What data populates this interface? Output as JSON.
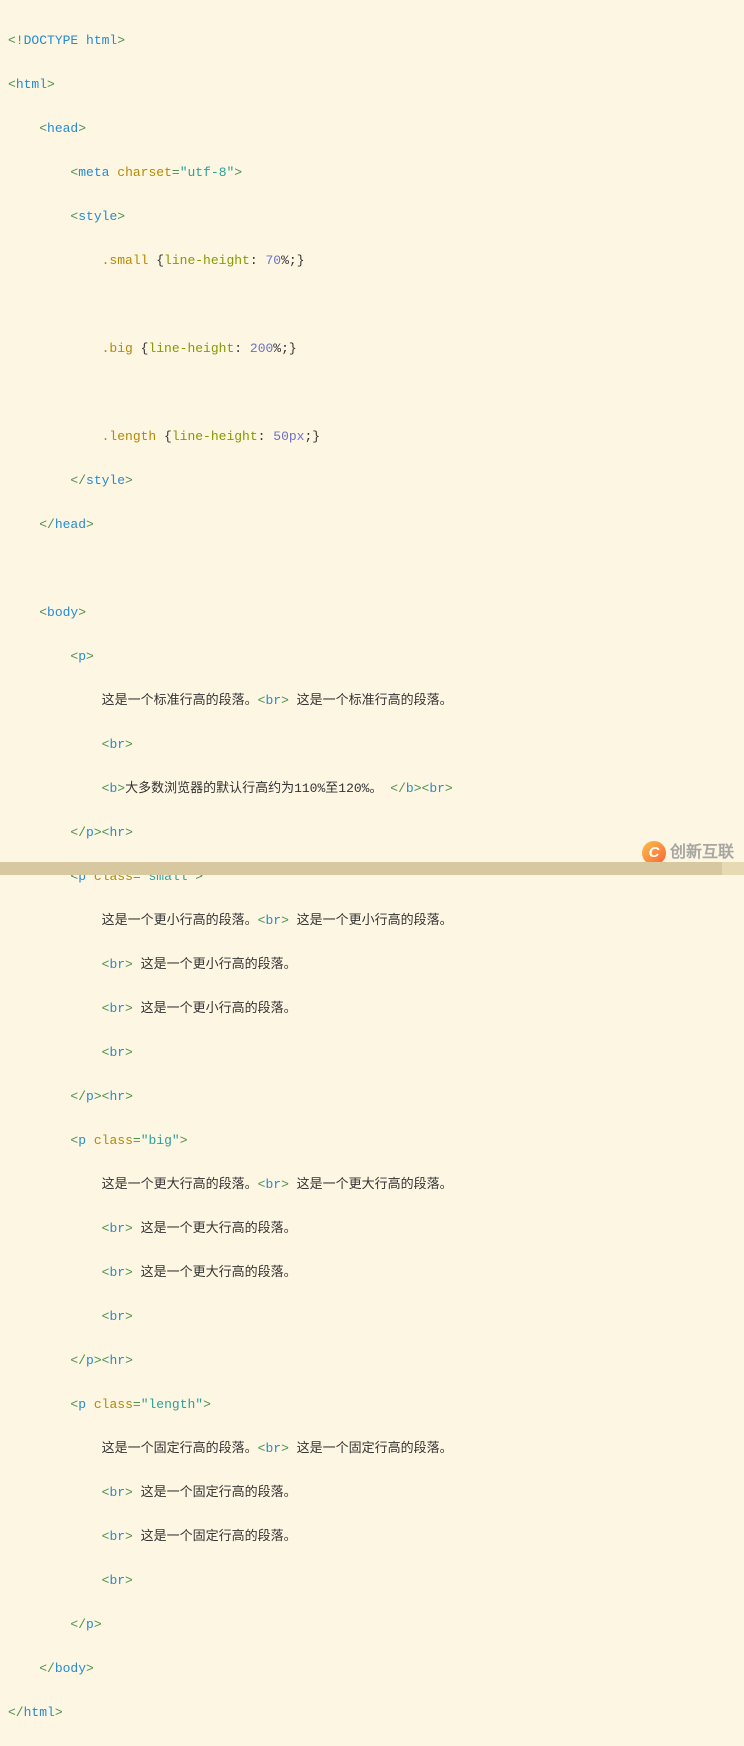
{
  "code": {
    "l1": "<!DOCTYPE html>",
    "l2_open": "<",
    "l2_tag": "html",
    "l2_close": ">",
    "head_open": "head",
    "meta_tag": "meta",
    "meta_attr": "charset",
    "meta_val": "\"utf-8\"",
    "style_tag": "style",
    "css_small_class": ".small",
    "css_small_prop": "line-height",
    "css_small_val": "70",
    "css_big_class": ".big",
    "css_big_prop": "line-height",
    "css_big_val": "200",
    "css_length_class": ".length",
    "css_length_prop": "line-height",
    "css_length_val": "50px",
    "body_tag": "body",
    "p_tag": "p",
    "hr_tag": "hr",
    "br_tag": "br",
    "b_tag": "b",
    "class_attr": "class",
    "class_small": "\"small\"",
    "class_big": "\"big\"",
    "class_length": "\"length\"",
    "txt_std_1": "这是一个标准行高的段落。",
    "txt_std_2": " 这是一个标准行高的段落。",
    "txt_bold": "大多数浏览器的默认行高约为110%至120%。 ",
    "txt_small_a": "这是一个更小行高的段落。",
    "txt_small_b": " 这是一个更小行高的段落。",
    "txt_small_c": " 这是一个更小行高的段落。",
    "txt_small_d": " 这是一个更小行高的段落。",
    "txt_big_a": "这是一个更大行高的段落。",
    "txt_big_b": " 这是一个更大行高的段落。",
    "txt_big_c": " 这是一个更大行高的段落。",
    "txt_big_d": " 这是一个更大行高的段落。",
    "txt_len_a": "这是一个固定行高的段落。",
    "txt_len_b": " 这是一个固定行高的段落。",
    "txt_len_c": " 这是一个固定行高的段落。",
    "txt_len_d": " 这是一个固定行高的段落。",
    "percent": "%",
    "semi": ";}",
    "open_brace": " {",
    "colon": ": "
  },
  "watermark": {
    "icon": "C",
    "text": "创新互联"
  }
}
